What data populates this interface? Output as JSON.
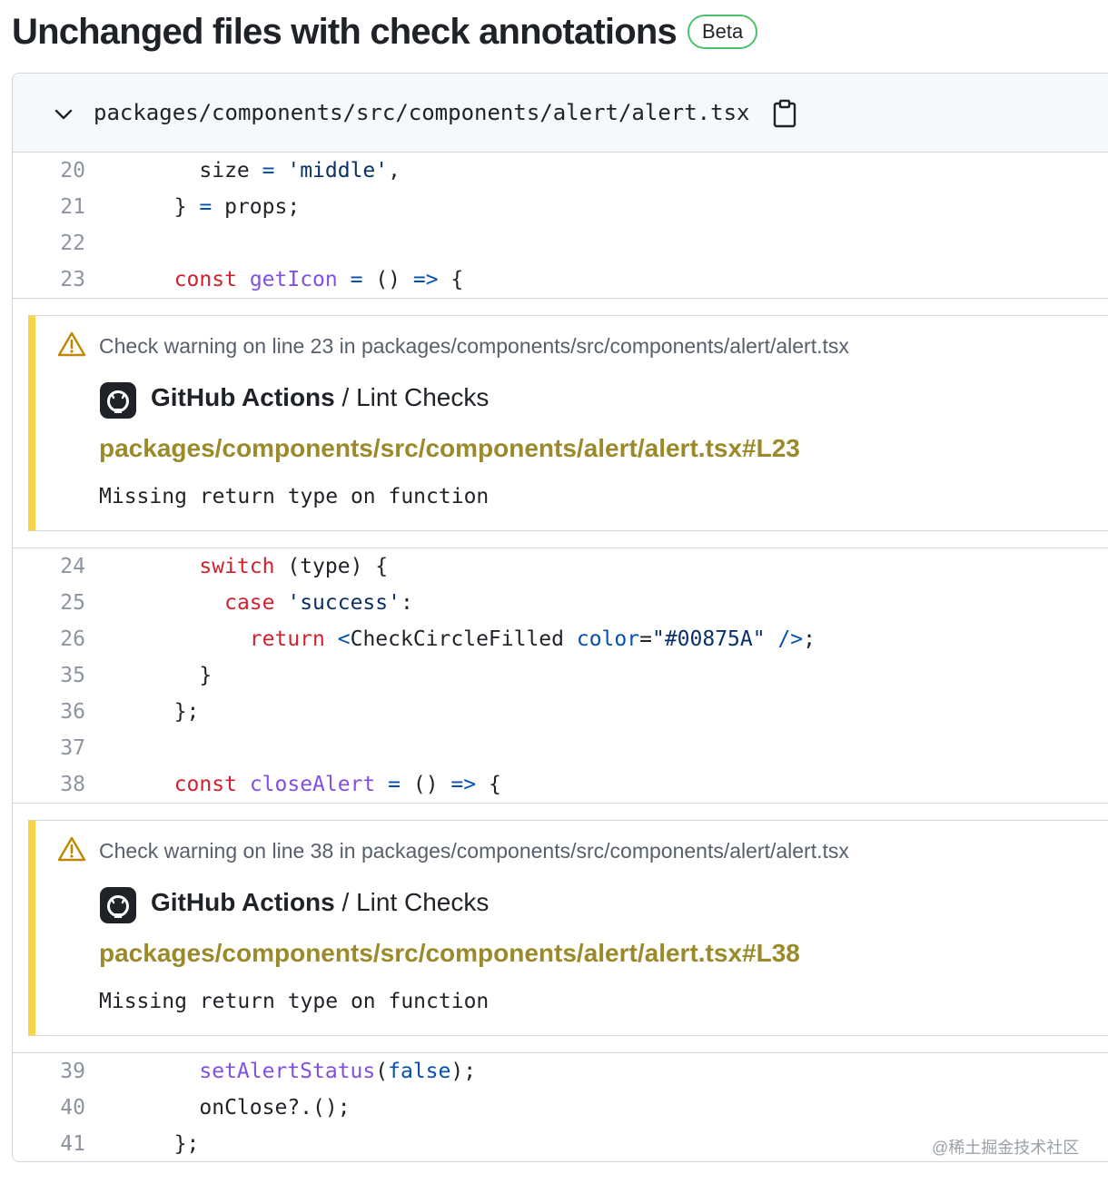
{
  "page": {
    "title": "Unchanged files with check annotations",
    "badge": "Beta"
  },
  "file": {
    "path": "packages/components/src/components/alert/alert.tsx",
    "icons": {
      "collapse": "chevron-down-icon",
      "copy": "clipboard-icon"
    }
  },
  "code_blocks": [
    {
      "lines": [
        {
          "num": "20",
          "tokens": [
            {
              "t": "    size ",
              "c": ""
            },
            {
              "t": "=",
              "c": "op"
            },
            {
              "t": " ",
              "c": ""
            },
            {
              "t": "'middle'",
              "c": "str"
            },
            {
              "t": ",",
              "c": ""
            }
          ]
        },
        {
          "num": "21",
          "tokens": [
            {
              "t": "  } ",
              "c": ""
            },
            {
              "t": "=",
              "c": "op"
            },
            {
              "t": " props;",
              "c": ""
            }
          ]
        },
        {
          "num": "22",
          "tokens": []
        },
        {
          "num": "23",
          "tokens": [
            {
              "t": "  ",
              "c": ""
            },
            {
              "t": "const",
              "c": "kw"
            },
            {
              "t": " ",
              "c": ""
            },
            {
              "t": "getIcon",
              "c": "fn"
            },
            {
              "t": " ",
              "c": ""
            },
            {
              "t": "=",
              "c": "op"
            },
            {
              "t": " () ",
              "c": ""
            },
            {
              "t": "=>",
              "c": "op"
            },
            {
              "t": " {",
              "c": ""
            }
          ]
        }
      ]
    },
    {
      "lines": [
        {
          "num": "24",
          "tokens": [
            {
              "t": "    ",
              "c": ""
            },
            {
              "t": "switch",
              "c": "kw"
            },
            {
              "t": " (type) {",
              "c": ""
            }
          ]
        },
        {
          "num": "25",
          "tokens": [
            {
              "t": "      ",
              "c": ""
            },
            {
              "t": "case",
              "c": "kw"
            },
            {
              "t": " ",
              "c": ""
            },
            {
              "t": "'success'",
              "c": "str"
            },
            {
              "t": ":",
              "c": ""
            }
          ]
        },
        {
          "num": "26",
          "tokens": [
            {
              "t": "        ",
              "c": ""
            },
            {
              "t": "return",
              "c": "kw"
            },
            {
              "t": " ",
              "c": ""
            },
            {
              "t": "<",
              "c": "op"
            },
            {
              "t": "CheckCircleFilled",
              "c": ""
            },
            {
              "t": " ",
              "c": ""
            },
            {
              "t": "color",
              "c": "op"
            },
            {
              "t": "=",
              "c": ""
            },
            {
              "t": "\"#00875A\"",
              "c": "str"
            },
            {
              "t": " ",
              "c": ""
            },
            {
              "t": "/>",
              "c": "op"
            },
            {
              "t": ";",
              "c": ""
            }
          ]
        },
        {
          "num": "35",
          "tokens": [
            {
              "t": "    }",
              "c": ""
            }
          ]
        },
        {
          "num": "36",
          "tokens": [
            {
              "t": "  };",
              "c": ""
            }
          ]
        },
        {
          "num": "37",
          "tokens": []
        },
        {
          "num": "38",
          "tokens": [
            {
              "t": "  ",
              "c": ""
            },
            {
              "t": "const",
              "c": "kw"
            },
            {
              "t": " ",
              "c": ""
            },
            {
              "t": "closeAlert",
              "c": "fn"
            },
            {
              "t": " ",
              "c": ""
            },
            {
              "t": "=",
              "c": "op"
            },
            {
              "t": " () ",
              "c": ""
            },
            {
              "t": "=>",
              "c": "op"
            },
            {
              "t": " {",
              "c": ""
            }
          ]
        }
      ]
    },
    {
      "lines": [
        {
          "num": "39",
          "tokens": [
            {
              "t": "    ",
              "c": ""
            },
            {
              "t": "setAlertStatus",
              "c": "fn"
            },
            {
              "t": "(",
              "c": ""
            },
            {
              "t": "false",
              "c": "op"
            },
            {
              "t": ");",
              "c": ""
            }
          ]
        },
        {
          "num": "40",
          "tokens": [
            {
              "t": "    onClose?.();",
              "c": ""
            }
          ]
        },
        {
          "num": "41",
          "tokens": [
            {
              "t": "  };",
              "c": ""
            }
          ]
        }
      ]
    }
  ],
  "annotations": [
    {
      "warning": "Check warning on line 23 in packages/components/src/components/alert/alert.tsx",
      "source_app": "GitHub Actions",
      "source_sep": " / ",
      "source_job": "Lint Checks",
      "link": "packages/components/src/components/alert/alert.tsx#L23",
      "message": "Missing return type on function"
    },
    {
      "warning": "Check warning on line 38 in packages/components/src/components/alert/alert.tsx",
      "source_app": "GitHub Actions",
      "source_sep": " / ",
      "source_job": "Lint Checks",
      "link": "packages/components/src/components/alert/alert.tsx#L38",
      "message": "Missing return type on function"
    }
  ],
  "watermark": "@稀土掘金技术社区",
  "colors": {
    "warning_bar": "#f5d54a",
    "beta_border": "#4ac26b",
    "link": "#9a8a2a",
    "keyword": "#cf222e",
    "function": "#8250df",
    "operator": "#0550ae",
    "string": "#0a3069"
  }
}
